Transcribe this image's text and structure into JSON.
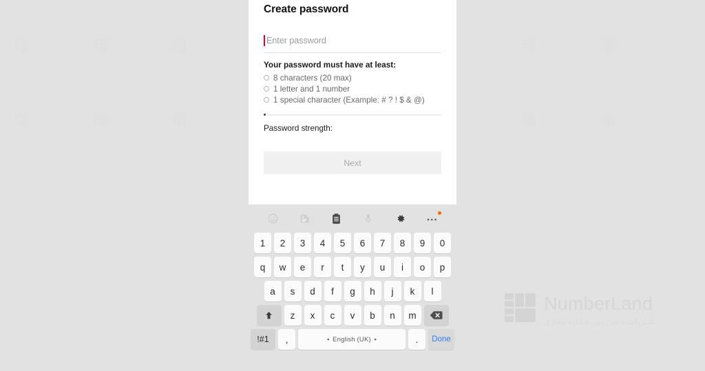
{
  "app": {
    "title": "Create password"
  },
  "form": {
    "password_placeholder": "Enter password",
    "password_value": "",
    "requirements_title": "Your password must have at least:",
    "requirements": [
      {
        "label": "8 characters (20 max)",
        "met": false
      },
      {
        "label": "1 letter and 1 number",
        "met": false
      },
      {
        "label": "1 special character (Example: # ? ! $ & @)",
        "met": false
      }
    ],
    "strength_label": "Password strength:",
    "strength_value": "",
    "next_label": "Next",
    "next_enabled": false
  },
  "keyboard": {
    "toolbar": [
      {
        "name": "emoji-icon",
        "label": "emoji",
        "state": "dim"
      },
      {
        "name": "sticker-icon",
        "label": "sticker",
        "state": "dim"
      },
      {
        "name": "clipboard-icon",
        "label": "clipboard",
        "state": "active"
      },
      {
        "name": "microphone-icon",
        "label": "microphone",
        "state": "dim"
      },
      {
        "name": "gear-icon",
        "label": "settings",
        "state": "active"
      },
      {
        "name": "more-options-icon",
        "label": "more",
        "state": "active",
        "badge": true
      }
    ],
    "row_numbers": [
      "1",
      "2",
      "3",
      "4",
      "5",
      "6",
      "7",
      "8",
      "9",
      "0"
    ],
    "row_top": [
      "q",
      "w",
      "e",
      "r",
      "t",
      "y",
      "u",
      "i",
      "o",
      "p"
    ],
    "row_home": [
      "a",
      "s",
      "d",
      "f",
      "g",
      "h",
      "j",
      "k",
      "l"
    ],
    "row_bottom": [
      "z",
      "x",
      "c",
      "v",
      "b",
      "n",
      "m"
    ],
    "shift_label": "shift",
    "backspace_label": "backspace",
    "symbols_label": "!#1",
    "comma_label": ",",
    "period_label": ".",
    "space_label": "English (UK)",
    "space_arrow_left": "◂",
    "space_arrow_right": "▸",
    "done_label": "Done"
  },
  "watermark": {
    "brand": "NumberLand",
    "subtitle": "تامین‌کننده سرزمین شماره مجازی"
  },
  "colors": {
    "page_background": "#e2e2e2",
    "phone_background": "#ffffff",
    "keyboard_background": "#e2e2e2",
    "key_face": "#fbfbfb",
    "key_function": "#d3d3d3",
    "done_accent": "#2f7bf4",
    "caret": "#e0002a",
    "badge": "#ef6c00",
    "disabled_button_bg": "#f0f0f0",
    "disabled_button_text": "#a8a8a8"
  }
}
